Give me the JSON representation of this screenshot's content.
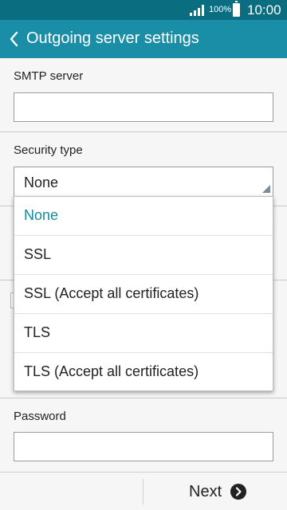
{
  "status_bar": {
    "battery_percent": "100%",
    "time": "10:00"
  },
  "app_bar": {
    "title": "Outgoing server settings"
  },
  "smtp": {
    "label": "SMTP server",
    "value": ""
  },
  "security": {
    "label": "Security type",
    "selected": "None",
    "options": [
      "None",
      "SSL",
      "SSL (Accept all certificates)",
      "TLS",
      "TLS (Accept all certificates)"
    ]
  },
  "password": {
    "label": "Password",
    "value": ""
  },
  "footer": {
    "next_label": "Next"
  },
  "colors": {
    "status_bar": "#0b6d80",
    "app_bar": "#1a8ea7",
    "selected_option": "#148a9c"
  }
}
